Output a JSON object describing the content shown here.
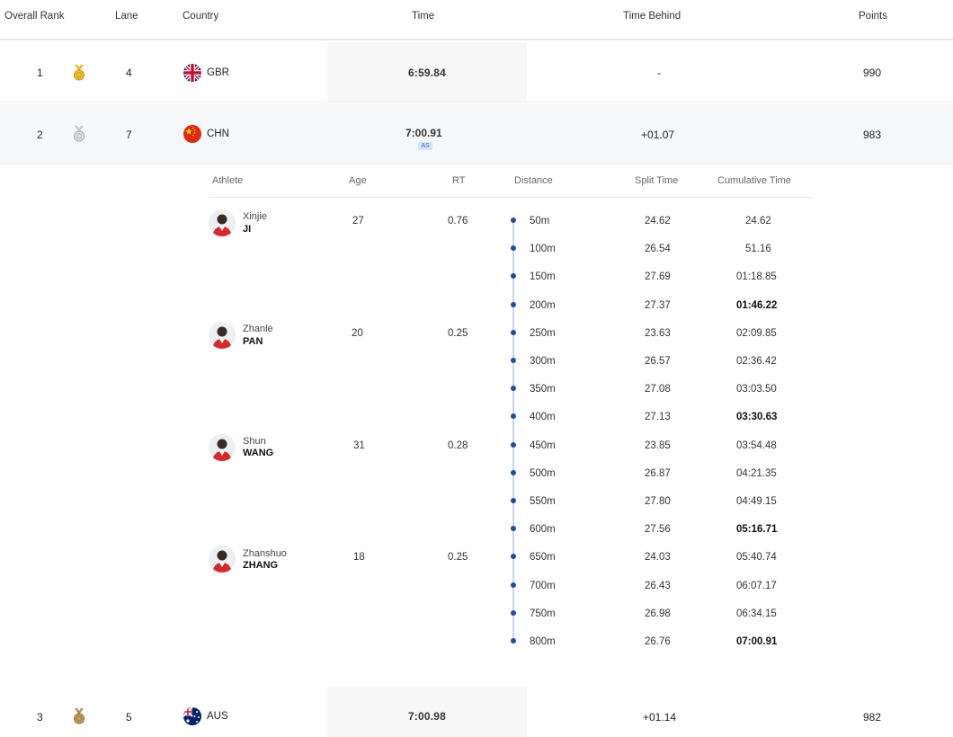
{
  "columns": {
    "rank": "Overall Rank",
    "lane": "Lane",
    "country": "Country",
    "time": "Time",
    "behind": "Time Behind",
    "points": "Points"
  },
  "rows": [
    {
      "rank": "1",
      "medal": "gold-medal-icon",
      "lane": "4",
      "country": "GBR",
      "time": "6:59.84",
      "behind": "-",
      "points": "990"
    },
    {
      "rank": "2",
      "medal": "silver-medal-icon",
      "lane": "7",
      "country": "CHN",
      "time": "7:00.91",
      "badge": "AS",
      "behind": "+01.07",
      "points": "983"
    },
    {
      "rank": "3",
      "medal": "bronze-medal-icon",
      "lane": "5",
      "country": "AUS",
      "time": "7:00.98",
      "behind": "+01.14",
      "points": "982"
    }
  ],
  "detail": {
    "headers": {
      "athlete": "Athlete",
      "age": "Age",
      "rt": "RT",
      "distance": "Distance",
      "split": "Split Time",
      "cumulative": "Cumulative Time"
    },
    "athletes": [
      {
        "first": "Xinjie",
        "last": "JI",
        "age": "27",
        "rt": "0.76"
      },
      {
        "first": "Zhanle",
        "last": "PAN",
        "age": "20",
        "rt": "0.25"
      },
      {
        "first": "Shun",
        "last": "WANG",
        "age": "31",
        "rt": "0.28"
      },
      {
        "first": "Zhanshuo",
        "last": "ZHANG",
        "age": "18",
        "rt": "0.25"
      }
    ],
    "splits": [
      {
        "distance": "50m",
        "split": "24.62",
        "cumulative": "24.62",
        "bold": false
      },
      {
        "distance": "100m",
        "split": "26.54",
        "cumulative": "51.16",
        "bold": false
      },
      {
        "distance": "150m",
        "split": "27.69",
        "cumulative": "01:18.85",
        "bold": false
      },
      {
        "distance": "200m",
        "split": "27.37",
        "cumulative": "01:46.22",
        "bold": true
      },
      {
        "distance": "250m",
        "split": "23.63",
        "cumulative": "02:09.85",
        "bold": false
      },
      {
        "distance": "300m",
        "split": "26.57",
        "cumulative": "02:36.42",
        "bold": false
      },
      {
        "distance": "350m",
        "split": "27.08",
        "cumulative": "03:03.50",
        "bold": false
      },
      {
        "distance": "400m",
        "split": "27.13",
        "cumulative": "03:30.63",
        "bold": true
      },
      {
        "distance": "450m",
        "split": "23.85",
        "cumulative": "03:54.48",
        "bold": false
      },
      {
        "distance": "500m",
        "split": "26.87",
        "cumulative": "04:21.35",
        "bold": false
      },
      {
        "distance": "550m",
        "split": "27.80",
        "cumulative": "04:49.15",
        "bold": false
      },
      {
        "distance": "600m",
        "split": "27.56",
        "cumulative": "05:16.71",
        "bold": true
      },
      {
        "distance": "650m",
        "split": "24.03",
        "cumulative": "05:40.74",
        "bold": false
      },
      {
        "distance": "700m",
        "split": "26.43",
        "cumulative": "06:07.17",
        "bold": false
      },
      {
        "distance": "750m",
        "split": "26.98",
        "cumulative": "06:34.15",
        "bold": false
      },
      {
        "distance": "800m",
        "split": "26.76",
        "cumulative": "07:00.91",
        "bold": true
      }
    ]
  },
  "colors": {
    "gold": "#e8b321",
    "silver": "#c9c9c9",
    "bronze": "#b08a4e",
    "timeline_dot": "#1d4fa0",
    "timeline_line": "#c7d7ef",
    "badge_bg": "#d4e3f7"
  }
}
